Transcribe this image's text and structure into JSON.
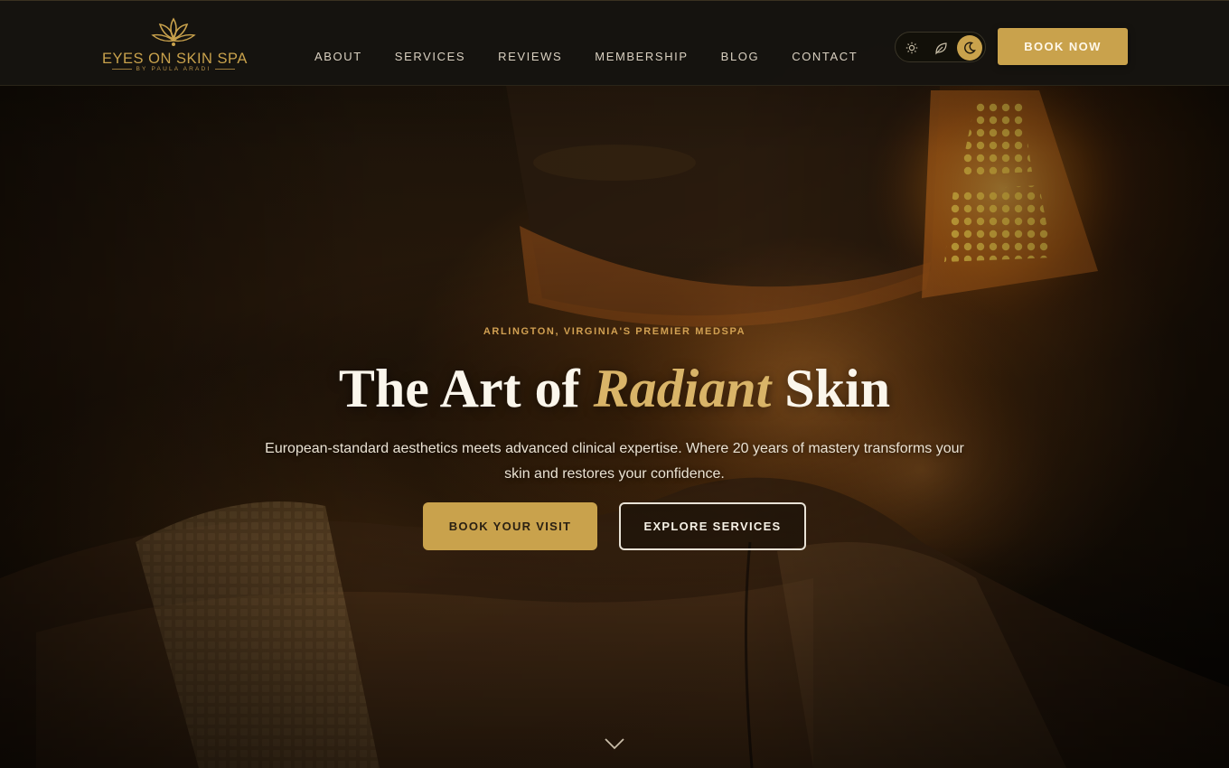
{
  "brand": {
    "name": "EYES ON SKIN SPA",
    "tagline": "BY PAULA ARADI",
    "gold": "#c9a24c"
  },
  "nav": {
    "items": [
      {
        "label": "ABOUT"
      },
      {
        "label": "SERVICES"
      },
      {
        "label": "REVIEWS"
      },
      {
        "label": "MEMBERSHIP"
      },
      {
        "label": "BLOG"
      },
      {
        "label": "CONTACT"
      }
    ]
  },
  "theme_switch": {
    "options": [
      {
        "icon": "sun-icon",
        "active": false
      },
      {
        "icon": "leaf-icon",
        "active": false
      },
      {
        "icon": "moon-icon",
        "active": true
      }
    ]
  },
  "header": {
    "book_now_label": "BOOK NOW"
  },
  "hero": {
    "eyebrow": "ARLINGTON, VIRGINIA'S PREMIER MEDSPA",
    "headline_before": "The Art of ",
    "headline_accent": "Radiant",
    "headline_after": " Skin",
    "lede": "European-standard aesthetics meets advanced clinical expertise. Where 20 years of mastery transforms your skin and restores your confidence.",
    "primary_cta": "BOOK YOUR VISIT",
    "secondary_cta": "EXPLORE SERVICES",
    "scroll_icon": "chevron-down-icon",
    "background_image": "client under LED light therapy panel with facial steam"
  }
}
